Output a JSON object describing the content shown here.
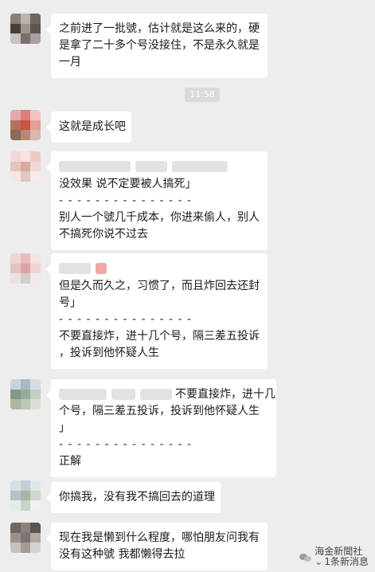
{
  "timestamp": "11:58",
  "messages": [
    {
      "lines": [
        "之前进了一批號，估计就是这么来的，硬",
        "是拿了二十多个号没接住，不是永久就是",
        "一月"
      ]
    },
    {
      "lines": [
        "这就是成长吧"
      ]
    },
    {
      "quote": [
        "没效果  说不定要被人搞死」"
      ],
      "divider": "- - - - - - - - - - - - - - -",
      "lines": [
        "别人一个號几千成本，你进来偷人，别人",
        "不搞死你说不过去"
      ]
    },
    {
      "quote": [
        "但是久而久之，习惯了，而且炸回去还封",
        "号」"
      ],
      "divider": "- - - - - - - - - - - - - - -",
      "lines": [
        "不要直接炸，进十几个号，隔三差五投诉",
        "，投诉到他怀疑人生"
      ]
    },
    {
      "quote": [
        "：不要直接炸，进十几",
        "个号，隔三差五投诉，投诉到他怀疑人生",
        "」"
      ],
      "divider": "- - - - - - - - - - - - - - -",
      "lines": [
        "正解"
      ]
    },
    {
      "lines": [
        "你搞我，没有我不搞回去的道理"
      ]
    },
    {
      "lines": [
        "现在我是懒到什么程度，哪怕朋友问我有",
        "没有这种號  我都懒得去拉"
      ]
    }
  ],
  "watermark": {
    "line1": "海金新聞社",
    "line2": "1条新消息"
  }
}
